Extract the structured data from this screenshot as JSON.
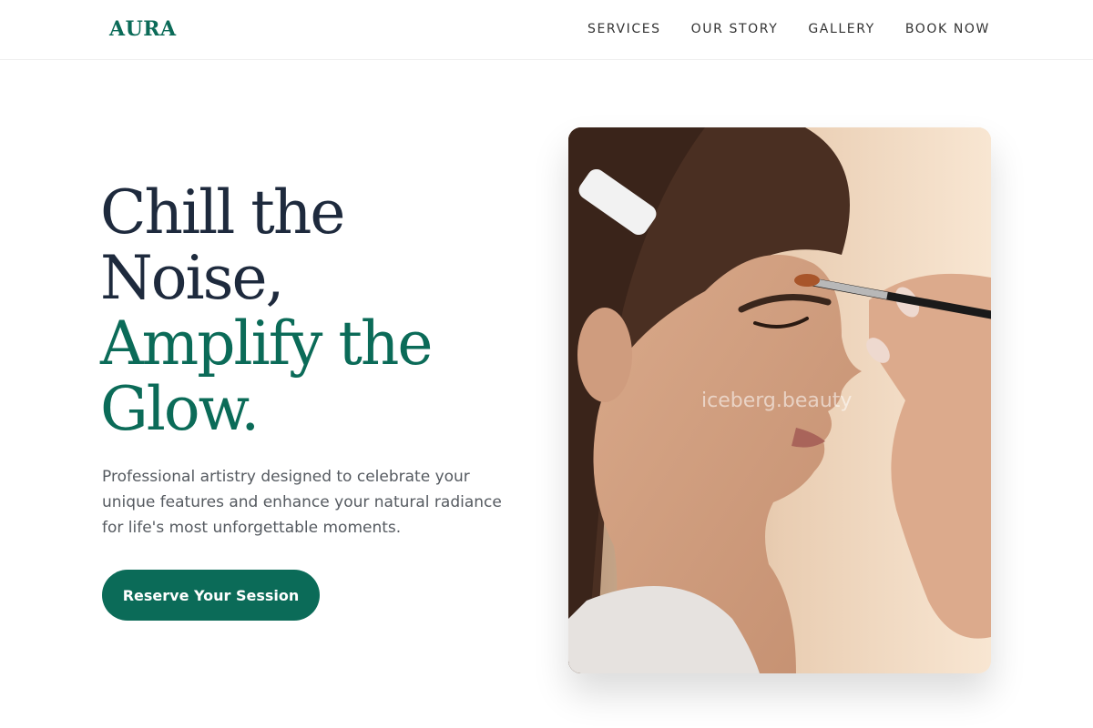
{
  "brand": {
    "logo": "AURA",
    "accent_color": "#0b6b58",
    "text_color": "#1e2a3d"
  },
  "nav": {
    "items": [
      {
        "label": "SERVICES"
      },
      {
        "label": "OUR STORY"
      },
      {
        "label": "GALLERY"
      },
      {
        "label": "BOOK NOW"
      }
    ]
  },
  "hero": {
    "title_line1": "Chill the",
    "title_line2": "Noise,",
    "title_line3": "Amplify the",
    "title_line4": "Glow.",
    "description": "Professional artistry designed to celebrate your unique features and enhance your natural radiance for life's most unforgettable moments.",
    "cta_label": "Reserve Your Session"
  },
  "image": {
    "subject": "woman-receiving-eye-makeup-photo",
    "watermark": "iceberg.beauty"
  }
}
